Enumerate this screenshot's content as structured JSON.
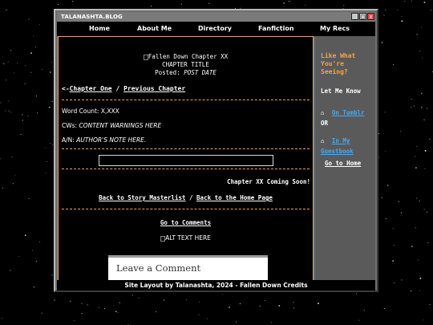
{
  "window": {
    "title": "TALANASHTA.BLOG",
    "minimize_glyph": "_",
    "maximize_glyph": "▢",
    "close_glyph": "x"
  },
  "nav": {
    "items": [
      "Home",
      "About Me",
      "Directory",
      "Fanfiction",
      "My Recs"
    ]
  },
  "chapter": {
    "header_image_alt": "Fallen Down Chapter XX",
    "title": "CHAPTER TITLE",
    "posted_label": "Posted: ",
    "posted_date": "POST DATE",
    "prev_prefix": "<-",
    "prev_chapter_one": "Chapter One",
    "separator": " / ",
    "prev_previous": "Previous Chapter",
    "word_count": "Word Count: X,XXX",
    "cws_label": "CWs: ",
    "cws_value": "CONTENT WARNINGS HERE",
    "an_label": "A/N: ",
    "an_value": "AUTHOR'S NOTE HERE.",
    "next_notice": "Chapter XX Coming Soon!",
    "back_masterlist": "Back to Story Masterlist",
    "back_separator": " / ",
    "back_home": "Back to the Home Page",
    "go_comments": "Go to Comments",
    "alt_text_image": "ALT TEXT HERE",
    "leave_comment": "Leave a Comment"
  },
  "sidebar": {
    "heading": "Like What You're Seeing?",
    "let_me_know": "Let Me Know",
    "tumblr_link": "On Tumblr",
    "or": "OR",
    "guestbook_link": "In My Guestbook",
    "go_home": "Go to Home"
  },
  "footer": {
    "text": "Site Layout by Talanashta, 2024 - Fallen Down Credits"
  },
  "colors": {
    "accent_orange": "#e8a36a",
    "sidebar_heading": "#f5a445",
    "link_blue": "#4aa8f0",
    "close_red": "#e24a4a"
  },
  "icons": {
    "home": "home-icon",
    "broken_image": "broken-image-icon"
  }
}
